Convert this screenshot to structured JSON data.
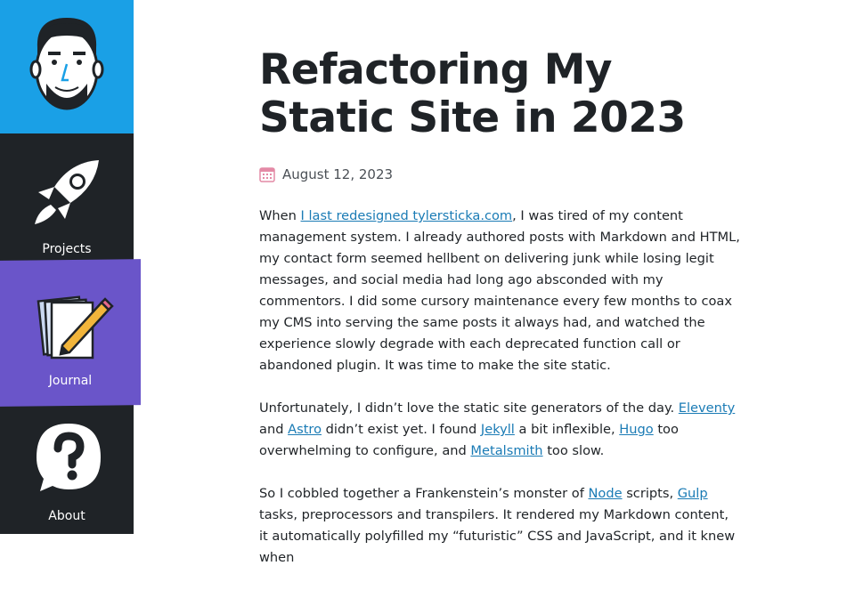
{
  "sidebar": {
    "items": [
      {
        "label": "Projects"
      },
      {
        "label": "Journal"
      },
      {
        "label": "About"
      }
    ]
  },
  "post": {
    "title_line1": "Refactoring My",
    "title_line2": "Static Site in 2023",
    "date": "August 12, 2023",
    "p1": {
      "t1": "When ",
      "link1": "I last redesigned tylersticka.com",
      "t2": ", I was tired of my content management system. I already authored posts with Markdown and HTML, my contact form seemed hellbent on delivering junk while losing legit messages, and social media had long ago absconded with my commentors. I did some cursory maintenance every few months to coax my CMS into serving the same posts it always had, and watched the experience slowly degrade with each deprecated function call or abandoned plugin. It was time to make the site static."
    },
    "p2": {
      "t1": "Unfortunately, I didn’t love the static site generators of the day. ",
      "link1": "Eleventy",
      "t2": " and ",
      "link2": "Astro",
      "t3": " didn’t exist yet. I found ",
      "link3": "Jekyll",
      "t4": " a bit inflexible, ",
      "link4": "Hugo",
      "t5": " too overwhelming to configure, and ",
      "link5": "Metalsmith",
      "t6": " too slow."
    },
    "p3": {
      "t1": "So I cobbled together a Frankenstein’s monster of ",
      "link1": "Node",
      "t2": " scripts, ",
      "link2": "Gulp",
      "t3": " tasks, preprocessors and transpilers. It rendered my Markdown content, it automatically polyfilled my “futuristic” CSS and JavaScript, and it knew when"
    }
  },
  "icons": {
    "avatar": "avatar-face-icon",
    "projects": "rocket-icon",
    "journal": "notebook-pencil-icon",
    "about": "question-bubble-icon",
    "date": "calendar-icon"
  },
  "colors": {
    "sidebar_bg": "#1f2327",
    "avatar_bg": "#1aa0e6",
    "journal_bg": "#6a55c9",
    "link": "#1a7bb5"
  }
}
